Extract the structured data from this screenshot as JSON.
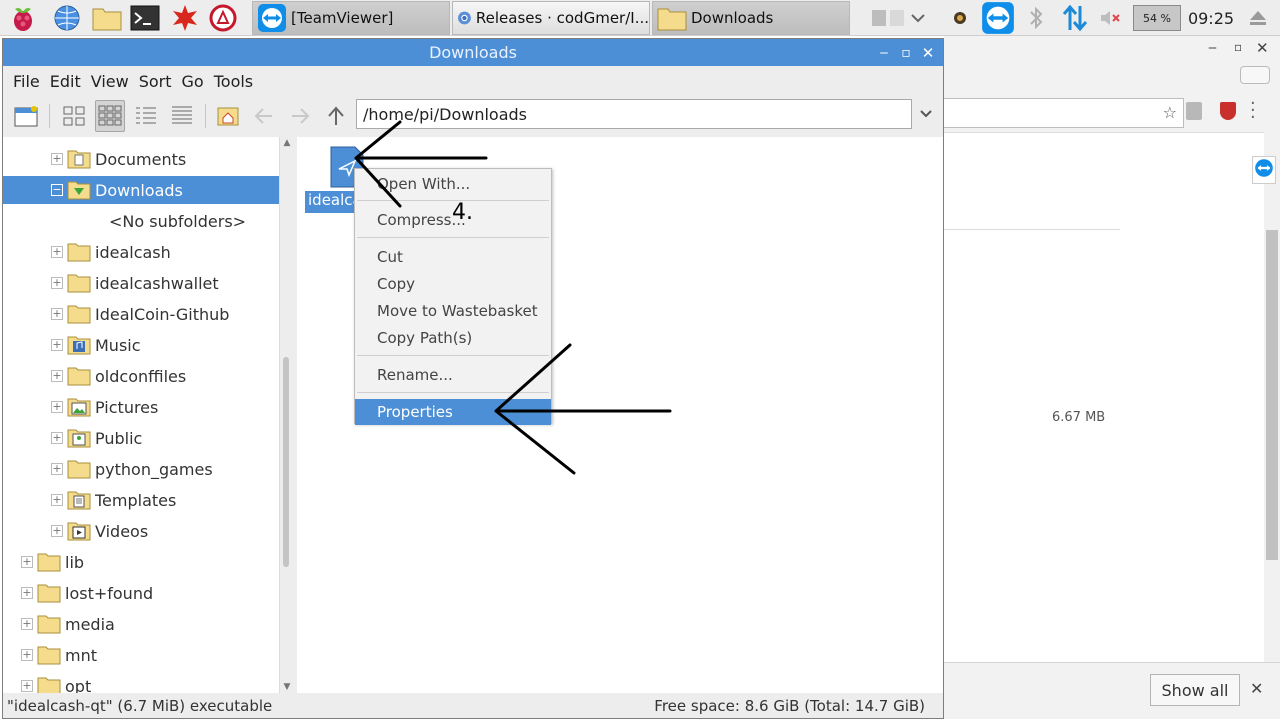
{
  "taskbar": {
    "tasks": [
      {
        "label": "[TeamViewer]",
        "icon": "teamviewer-icon"
      },
      {
        "label": "Releases · codGmer/I...",
        "icon": "chromium-icon"
      },
      {
        "label": "Downloads",
        "icon": "folder-icon"
      }
    ],
    "battery": "54 %",
    "clock": "09:25"
  },
  "window": {
    "title": "Downloads",
    "menu": [
      "File",
      "Edit",
      "View",
      "Sort",
      "Go",
      "Tools"
    ],
    "path": "/home/pi/Downloads"
  },
  "tree": {
    "items": [
      {
        "label": "Documents",
        "expander": "+",
        "icon": "documents-folder"
      },
      {
        "label": "Downloads",
        "expander": "−",
        "icon": "downloads-folder"
      },
      {
        "label": "<No subfolders>",
        "expander": "",
        "icon": ""
      },
      {
        "label": "idealcash",
        "expander": "+",
        "icon": "folder"
      },
      {
        "label": "idealcashwallet",
        "expander": "+",
        "icon": "folder"
      },
      {
        "label": "IdealCoin-Github",
        "expander": "+",
        "icon": "folder"
      },
      {
        "label": "Music",
        "expander": "+",
        "icon": "music-folder"
      },
      {
        "label": "oldconffiles",
        "expander": "+",
        "icon": "folder"
      },
      {
        "label": "Pictures",
        "expander": "+",
        "icon": "pictures-folder"
      },
      {
        "label": "Public",
        "expander": "+",
        "icon": "public-folder"
      },
      {
        "label": "python_games",
        "expander": "+",
        "icon": "folder"
      },
      {
        "label": "Templates",
        "expander": "+",
        "icon": "templates-folder"
      },
      {
        "label": "Videos",
        "expander": "+",
        "icon": "videos-folder"
      },
      {
        "label": "lib",
        "expander": "+",
        "icon": "folder"
      },
      {
        "label": "lost+found",
        "expander": "+",
        "icon": "folder"
      },
      {
        "label": "media",
        "expander": "+",
        "icon": "folder"
      },
      {
        "label": "mnt",
        "expander": "+",
        "icon": "folder"
      },
      {
        "label": "opt",
        "expander": "+",
        "icon": "folder"
      }
    ]
  },
  "file": {
    "label": "idealcash-qt",
    "label_visible": "idealcas"
  },
  "context_menu": {
    "items": [
      "Open With...",
      "Compress...",
      "Cut",
      "Copy",
      "Move to Wastebasket",
      "Copy Path(s)",
      "Rename...",
      "Properties"
    ]
  },
  "status": {
    "left": "\"idealcash-qt\" (6.7 MiB) executable",
    "right": "Free space: 8.6 GiB (Total: 14.7 GiB)"
  },
  "annotation": {
    "step": "4."
  },
  "browser_bg": {
    "download_size": "6.67 MB",
    "show_all": "Show all"
  },
  "colors": {
    "accent": "#4d8fd6",
    "folder": "#f4dc8c"
  }
}
